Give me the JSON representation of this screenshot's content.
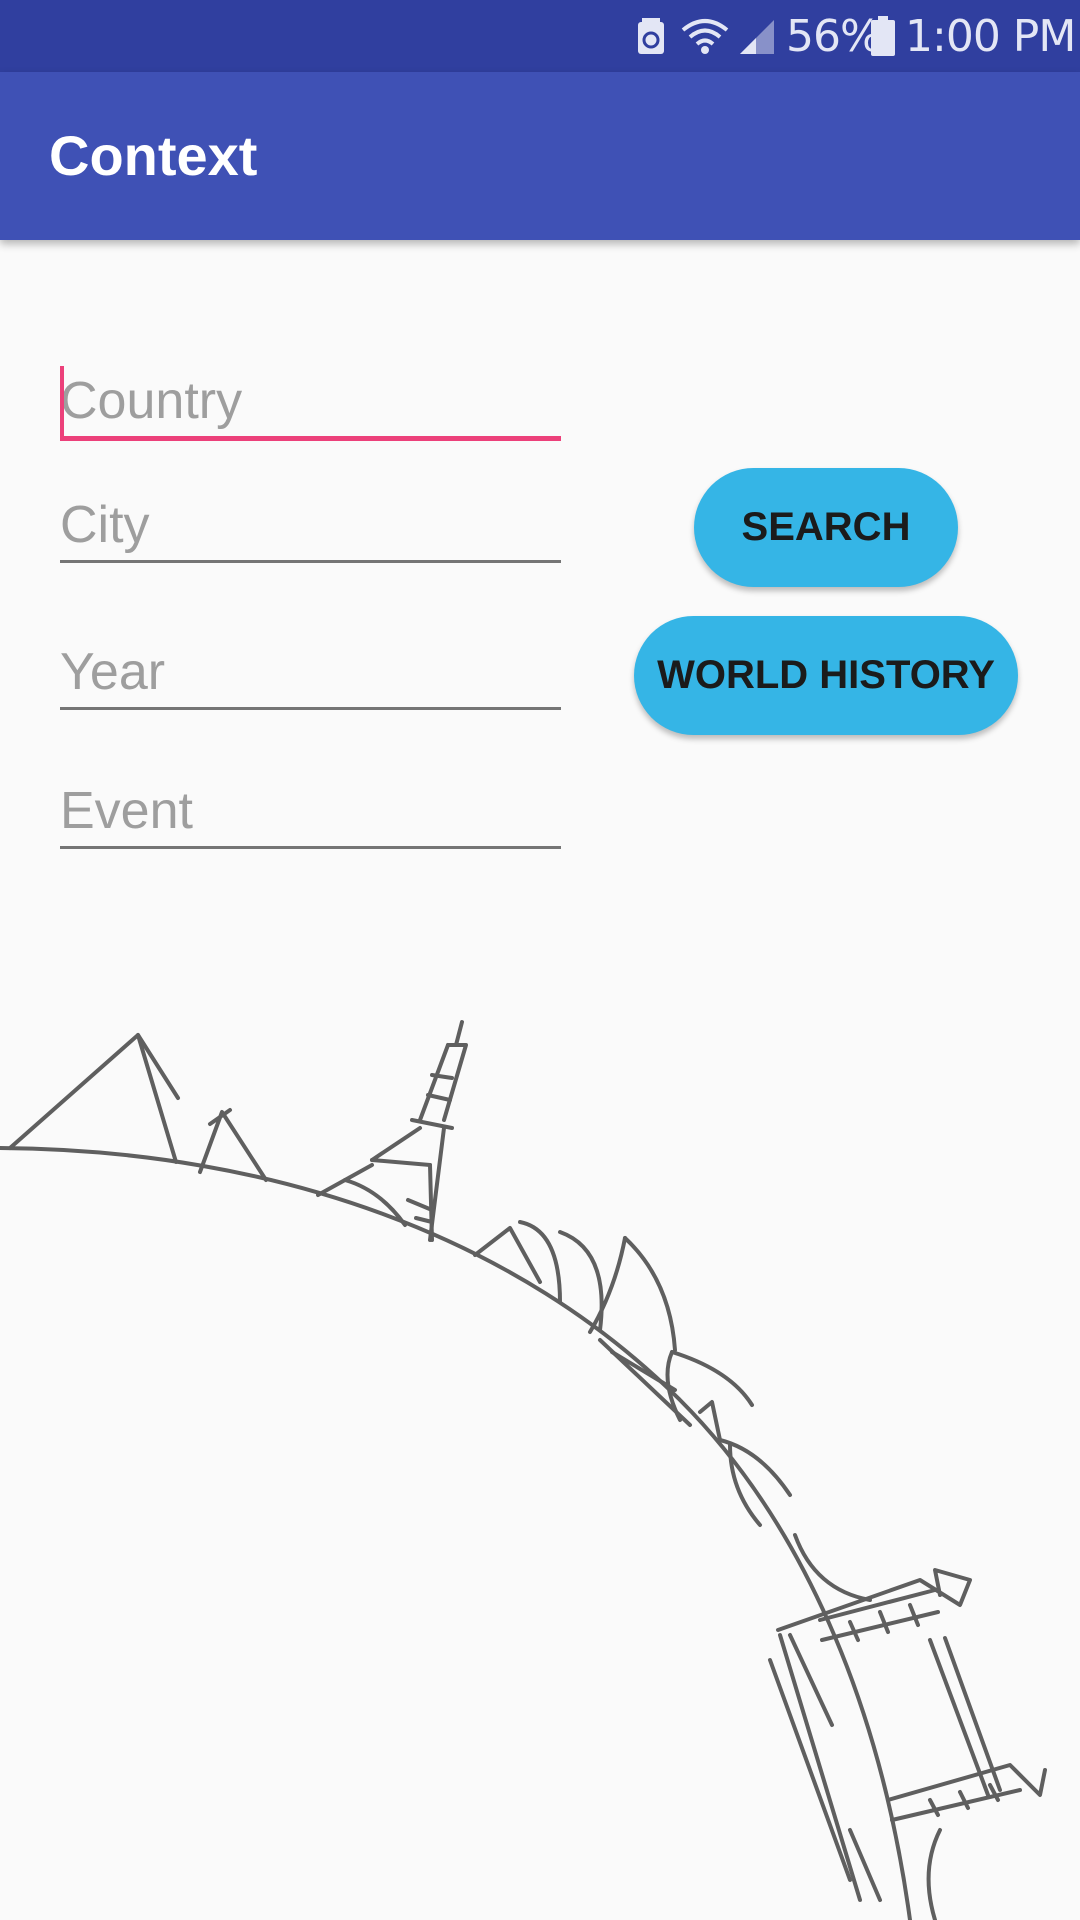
{
  "status_bar": {
    "battery_percent": "56%",
    "time": "1:00 PM",
    "icons": [
      "battery-saver-icon",
      "wifi-icon",
      "signal-icon",
      "battery-icon"
    ]
  },
  "app_bar": {
    "title": "Context"
  },
  "form": {
    "country": {
      "placeholder": "Country",
      "value": ""
    },
    "city": {
      "placeholder": "City",
      "value": ""
    },
    "year": {
      "placeholder": "Year",
      "value": ""
    },
    "event": {
      "placeholder": "Event",
      "value": ""
    }
  },
  "buttons": {
    "search_label": "SEARCH",
    "world_history_label": "WORLD HISTORY"
  },
  "colors": {
    "status_bar": "#303f9f",
    "app_bar": "#3f51b5",
    "accent": "#ec407a",
    "button": "#35b5e6",
    "background": "#fafafa"
  },
  "illustration": {
    "icon": "world-landmarks-illustration"
  }
}
